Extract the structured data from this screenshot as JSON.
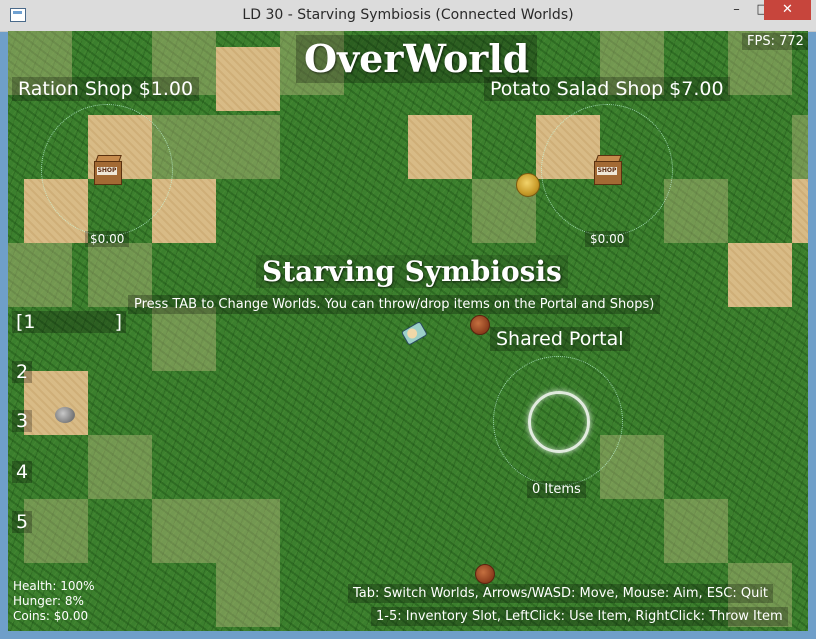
{
  "window": {
    "title": "LD 30 - Starving Symbiosis  (Connected Worlds)",
    "minimize_label": "–",
    "maximize_label": "□",
    "close_label": "✕"
  },
  "hud": {
    "world_name": "OverWorld",
    "fps": "FPS: 772",
    "game_name": "Starving Symbiosis",
    "instructions": "Press TAB to Change Worlds.  You can throw/drop items on the Portal and Shops)"
  },
  "shops": [
    {
      "label": "Ration  Shop  $1.00",
      "amount": "$0.00",
      "icon_text": "SHOP"
    },
    {
      "label": "Potato Salad  Shop  $7.00",
      "amount": "$0.00",
      "icon_text": "SHOP"
    }
  ],
  "portal": {
    "label": "Shared Portal",
    "item_count": "0 Items"
  },
  "inventory": {
    "slots": [
      "[1",
      "2",
      "3",
      "4",
      "5"
    ],
    "slot1_close": "]"
  },
  "stats": {
    "health": "Health: 100%",
    "hunger": "Hunger: 8%",
    "coins": "Coins: $0.00"
  },
  "help": {
    "line1": "Tab: Switch Worlds,  Arrows/WASD: Move,  Mouse: Aim,  ESC: Quit",
    "line2": "1-5: Inventory Slot,  LeftClick: Use Item,  RightClick: Throw Item"
  },
  "colors": {
    "grass": "#3b7f2d",
    "sand": "#d8bb86",
    "close_button": "#c7453c"
  }
}
